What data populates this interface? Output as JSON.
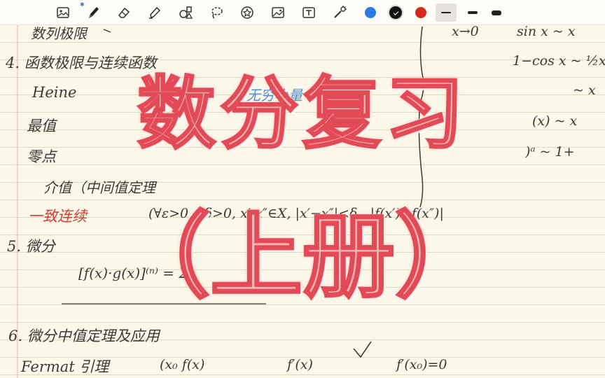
{
  "toolbar": {
    "tools": [
      {
        "name": "image-insert-icon",
        "active": false
      },
      {
        "name": "pen-icon",
        "active": true
      },
      {
        "name": "eraser-icon",
        "active": false
      },
      {
        "name": "highlighter-icon",
        "active": false
      },
      {
        "name": "shapes-icon",
        "active": false
      },
      {
        "name": "lasso-icon",
        "active": false
      },
      {
        "name": "sticker-icon",
        "active": false
      },
      {
        "name": "image-icon",
        "active": false
      },
      {
        "name": "text-box-icon",
        "active": false
      },
      {
        "name": "laser-pointer-icon",
        "active": false
      }
    ],
    "colors": [
      "#2a7be4",
      "#111111",
      "#d42a1e"
    ],
    "selected_color": "#111111",
    "stroke_widths": [
      "thin",
      "medium",
      "thick"
    ],
    "selected_stroke": "thin"
  },
  "notes": {
    "left": {
      "l0": "数列极限",
      "l1": "4. 函数极限与连续函数",
      "l2": "Heine",
      "l3": "最值",
      "l4": "零点",
      "l5": "介值（中间值定理",
      "l6": "一致连续",
      "l7": "5. 微分",
      "l8": "[f(x)·g(x)]⁽ⁿ⁾ = Σ",
      "l9": "6. 微分中值定理及应用",
      "l10": "Fermat 引理"
    },
    "right": {
      "r0": "x→0",
      "r1": "sin x ~ x",
      "r2": "1−cos x ~ ½x",
      "r3": "~ x",
      "r4": "(x) ~ x",
      "r5": ")ᵃ ~ 1+",
      "r6": "(∀ε>0, ∃δ>0, x′,x″∈X, |x′−x″|<δ , |f(x′)−f(x″)|",
      "r7": "(x₀  f(x)",
      "r8": "f′(x)",
      "r9": "f′(x₀)=0",
      "blue": "无穷小量"
    }
  },
  "cover": {
    "title": "数分复习",
    "subtitle": "（上册）"
  }
}
